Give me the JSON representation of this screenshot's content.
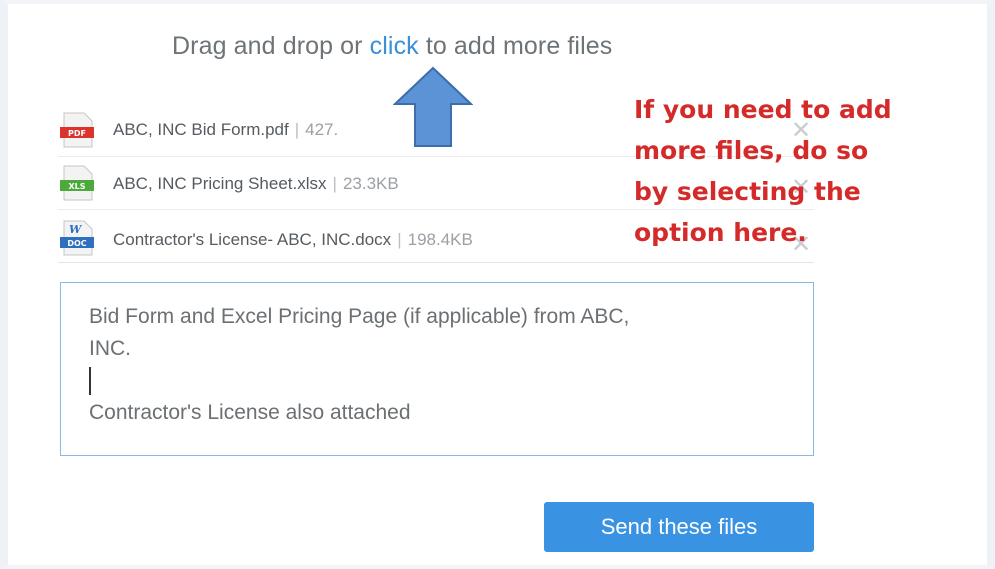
{
  "dropzone": {
    "text_before": "Drag and drop or",
    "link_label": "click",
    "text_after": "to add more files"
  },
  "annotation": {
    "line1": "If you need to add",
    "line2": "more files, do so",
    "line3": "by selecting the",
    "line4": "option here.",
    "color": "#d52a2a"
  },
  "files": [
    {
      "name": "ABC, INC Bid Form.pdf",
      "size": "427.",
      "icon": "pdf-file-icon",
      "badge": "PDF"
    },
    {
      "name": "ABC, INC Pricing Sheet.xlsx",
      "size": "23.3KB",
      "icon": "xls-file-icon",
      "badge": "XLS"
    },
    {
      "name": "Contractor's License- ABC, INC.docx",
      "size": "198.4KB",
      "icon": "doc-file-icon",
      "badge": "DOC",
      "badge_top": "W"
    }
  ],
  "message": {
    "line1": "Bid Form and Excel Pricing Page (if applicable) from ABC,",
    "line2": "INC.",
    "line4": "Contractor's License also attached"
  },
  "send_button": {
    "label": "Send these files",
    "color": "#3a92e3"
  },
  "remove_glyph": "✕",
  "separator": "|"
}
